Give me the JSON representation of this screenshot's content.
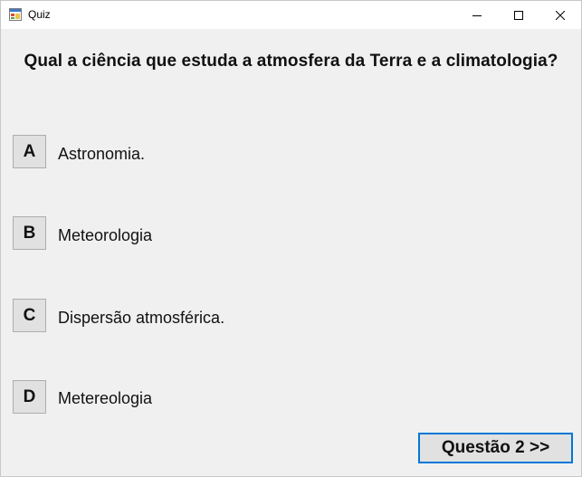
{
  "window": {
    "title": "Quiz",
    "icons": {
      "app": "app-icon",
      "minimize": "minimize-icon",
      "maximize": "maximize-icon",
      "close": "close-icon"
    }
  },
  "quiz": {
    "question": "Qual a ciência que estuda a atmosfera da Terra e a climatologia?",
    "options": [
      {
        "letter": "A",
        "text": "Astronomia."
      },
      {
        "letter": "B",
        "text": "Meteorologia"
      },
      {
        "letter": "C",
        "text": "Dispersão atmosférica."
      },
      {
        "letter": "D",
        "text": "Metereologia"
      }
    ],
    "next_label": "Questão 2 >>"
  },
  "colors": {
    "accent": "#0078d7",
    "background": "#f0f0f0",
    "button_face": "#e1e1e1"
  }
}
